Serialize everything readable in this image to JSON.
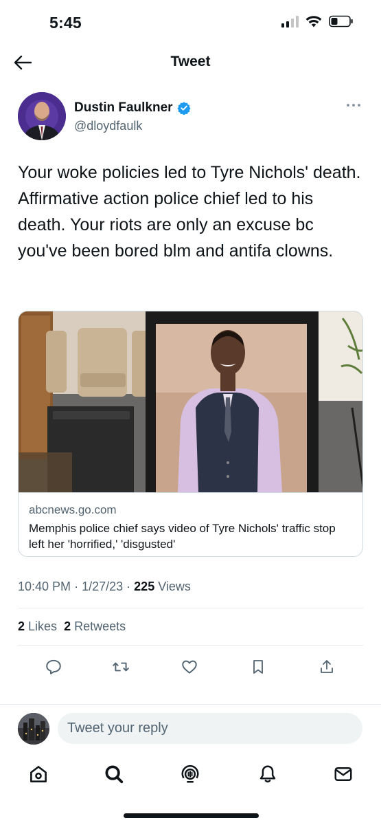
{
  "status_bar": {
    "time": "5:45"
  },
  "header": {
    "title": "Tweet"
  },
  "author": {
    "name": "Dustin Faulkner",
    "handle": "@dloydfaulk"
  },
  "tweet": {
    "text": "Your woke policies led to Tyre Nichols' death. Affirmative action police chief led to his death. Your riots are only an excuse bc you've been bored blm and antifa clowns."
  },
  "card": {
    "domain": "abcnews.go.com",
    "title": "Memphis police chief says video of Tyre Nichols' traffic stop left her 'horrified,' 'disgusted'"
  },
  "meta": {
    "time": "10:40 PM",
    "date": "1/27/23",
    "separator": "·",
    "views_count": "225",
    "views_label": "Views"
  },
  "stats": {
    "likes_count": "2",
    "likes_label": "Likes",
    "retweets_count": "2",
    "retweets_label": "Retweets"
  },
  "actions": [
    "reply-icon",
    "retweet-icon",
    "like-icon",
    "bookmark-icon",
    "share-icon"
  ],
  "reply": {
    "placeholder": "Tweet your reply"
  },
  "bottom_nav": [
    "home-icon",
    "search-icon",
    "spaces-icon",
    "notifications-icon",
    "messages-icon"
  ],
  "colors": {
    "text": "#0f1419",
    "secondary": "#536471",
    "verified": "#1d9bf0",
    "border": "#cfd9de"
  }
}
